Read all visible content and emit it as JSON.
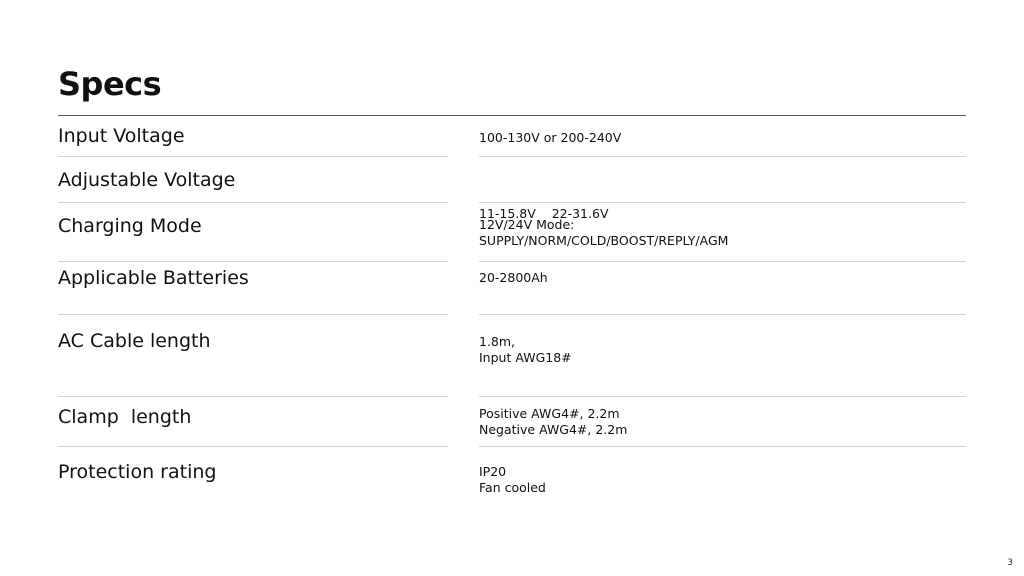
{
  "slide": {
    "title": "Specs",
    "page_number": "3"
  },
  "specs": [
    {
      "label": "Input Voltage",
      "value_lines": [
        "100-130V or 200-240V"
      ]
    },
    {
      "label": "Adjustable Voltage",
      "value_lines": [
        "11-15.8V    22-31.6V"
      ]
    },
    {
      "label": "Charging Mode",
      "value_lines": [
        "12V/24V Mode:",
        "SUPPLY/NORM/COLD/BOOST/REPLY/AGM"
      ]
    },
    {
      "label": "Applicable Batteries",
      "value_lines": [
        "20-2800Ah"
      ]
    },
    {
      "label": "AC Cable length",
      "value_lines": [
        "1.8m,",
        "Input AWG18#"
      ]
    },
    {
      "label": "Clamp  length",
      "value_lines": [
        "Positive AWG4#, 2.2m",
        "Negative AWG4#, 2.2m"
      ]
    },
    {
      "label": "Protection rating",
      "value_lines": [
        "IP20",
        "Fan cooled"
      ]
    }
  ]
}
